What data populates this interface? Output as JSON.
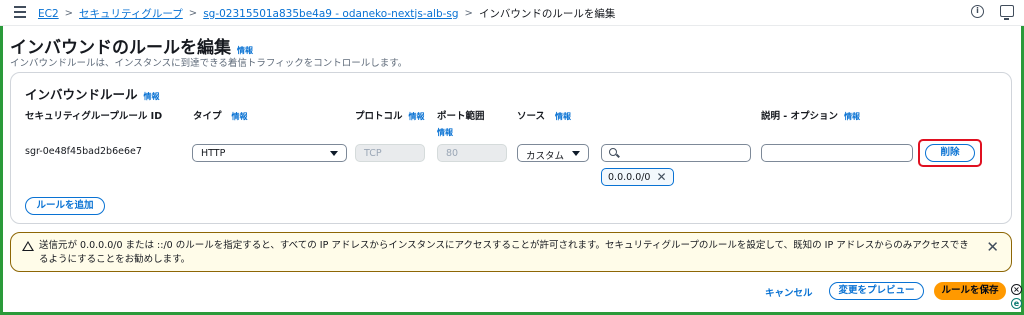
{
  "breadcrumbs": {
    "items": [
      "EC2",
      "セキュリティグループ",
      "sg-02315501a835be4a9 - odaneko-nextjs-alb-sg"
    ],
    "current": "インバウンドのルールを編集",
    "separator": ">"
  },
  "page": {
    "title": "インバウンドのルールを編集",
    "info": "情報",
    "description": "インバウンドルールは、インスタンスに到達できる着信トラフィックをコントロールします。"
  },
  "panel": {
    "title": "インバウンドルール",
    "info": "情報",
    "columns": {
      "rule_id": "セキュリティグループルール ID",
      "type": "タイプ",
      "protocol": "プロトコル",
      "port_range": "ポート範囲",
      "source": "ソース",
      "description": "説明 - オプション"
    },
    "info_label": "情報",
    "rule": {
      "id": "sgr-0e48f45bad2b6e6e7",
      "type": "HTTP",
      "protocol": "TCP",
      "port": "80",
      "source_mode": "カスタム",
      "source_search": "",
      "source_token": "0.0.0.0/0",
      "description": "",
      "delete_label": "削除"
    },
    "add_rule_label": "ルールを追加"
  },
  "alert": {
    "text": "送信元が 0.0.0.0/0 または ::/0 のルールを指定すると、すべての IP アドレスからインスタンスにアクセスすることが許可されます。セキュリティグループのルールを設定して、既知の IP アドレスからのみアクセスできるようにすることをお勧めします。"
  },
  "footer": {
    "cancel_label": "キャンセル",
    "preview_label": "変更をプレビュー",
    "save_label": "ルールを保存"
  },
  "colors": {
    "link": "#0972d3",
    "primary": "#ff9900",
    "highlight": "#e01020",
    "warning_border": "#8d6605",
    "warning_bg": "#fffce9"
  },
  "icons": {
    "menu": "menu-icon",
    "info": "info-icon",
    "screen": "screen-icon",
    "caret": "caret-down-icon",
    "search": "search-icon",
    "close": "close-icon",
    "warning": "warning-icon"
  }
}
